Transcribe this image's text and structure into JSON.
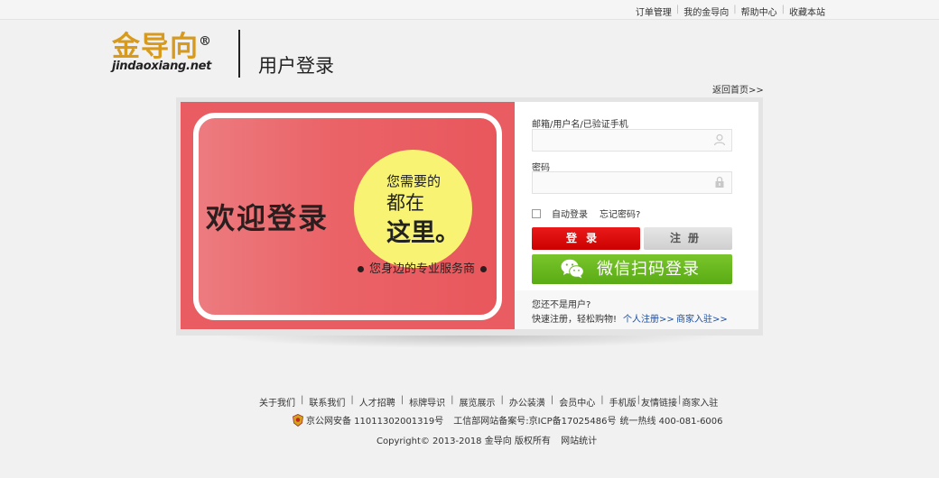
{
  "topbar": {
    "links": [
      "订单管理",
      "我的金导向",
      "帮助中心",
      "收藏本站"
    ]
  },
  "logo": {
    "cn": "金导向",
    "reg": "®",
    "en": "jindaoxiang.net"
  },
  "page_title": "用户登录",
  "back_home": "返回首页>>",
  "banner": {
    "welcome": "欢迎登录",
    "circle_line1": "您需要的",
    "circle_line2": "都在",
    "circle_line3": "这里。",
    "tagline": "您身边的专业服务商"
  },
  "form": {
    "username_label": "邮箱/用户名/已验证手机",
    "username_value": "",
    "password_label": "密码",
    "password_value": "",
    "auto_login": "自动登录",
    "forgot": "忘记密码?",
    "login_btn": "登录",
    "register_btn": "注册",
    "wechat_btn": "微信扫码登录",
    "not_user": "您还不是用户?",
    "quick_reg": "快速注册，轻松购物!",
    "personal_reg": "个人注册>>",
    "merchant_reg": "商家入驻>>"
  },
  "footer": {
    "links": [
      "关于我们",
      "联系我们",
      "人才招聘",
      "标牌导识",
      "展览展示",
      "办公装潢",
      "会员中心"
    ],
    "links2": [
      "手机版",
      "友情链接",
      "商家入驻"
    ],
    "police": "京公网安备 11011302001319号",
    "icp": "工信部网站备案号:京ICP备17025486号",
    "hotline": "统一热线 400-081-6006",
    "copyright": "Copyright© 2013-2018 金导向 版权所有",
    "stats": "网站统计"
  },
  "colors": {
    "accent_red": "#cc0000",
    "wechat_green": "#6bb820",
    "banner_red": "#e95d62",
    "circle_yellow": "#f8f372",
    "logo_gold": "#d89a1d"
  },
  "icons": [
    "user-icon",
    "lock-icon",
    "wechat-icon",
    "police-badge-icon"
  ]
}
